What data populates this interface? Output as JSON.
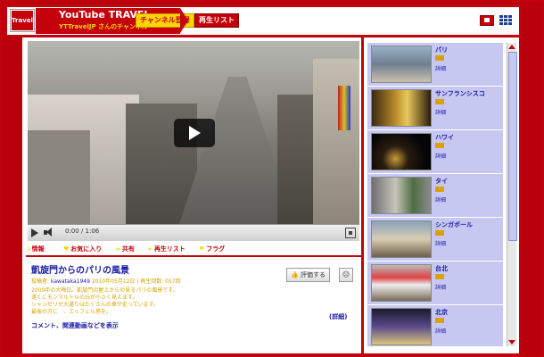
{
  "colors": {
    "brand_red": "#c4000b",
    "accent_yellow": "#ffd400",
    "link_blue": "#1a1aa6",
    "list_bg": "#c7c8f2"
  },
  "header": {
    "logo_text": "Travel",
    "title": "YouTube TRAVEL",
    "subtitle": "YTTravelJP さんのチャンネル",
    "subscribe_label": "チャンネル登録",
    "playlist_label": "再生リスト",
    "view_icons": [
      "player-view-icon",
      "grid-view-icon"
    ]
  },
  "player": {
    "time": "0:00 / 1:06",
    "icons": [
      "play-icon",
      "volume-icon",
      "fullscreen-icon"
    ]
  },
  "tabs": [
    {
      "label": "情報",
      "icon": "info-icon"
    },
    {
      "label": "お気に入り",
      "icon": "heart-icon"
    },
    {
      "label": "共有",
      "icon": "share-icon"
    },
    {
      "label": "再生リスト",
      "icon": "plus-icon"
    },
    {
      "label": "フラグ",
      "icon": "flag-icon"
    }
  ],
  "video": {
    "title": "凱旋門からのパリの風景",
    "meta_prefix": "投稿者:",
    "uploader": "kawataka1949",
    "meta_suffix": "2010年05月12日 | 再生回数: 057回",
    "description_lines": [
      "2009年の大晦日。凱旋門の屋上からの見るパリの風景です。",
      "遠くにモンマルトルの丘が小さく見えます。",
      "シャンゼリゼ大通りはたくさんの車が走っています。",
      "最後の方に　、エッフェル塔を。"
    ],
    "rate_label": "評価する",
    "dislike_symbol": "☹",
    "more_label": "(詳細)",
    "comments_label": "コメント、関連動画などを表示"
  },
  "playlist": {
    "detail_label": "詳細",
    "items": [
      {
        "title": "パリ"
      },
      {
        "title": "サンフランシスコ"
      },
      {
        "title": "ハワイ"
      },
      {
        "title": "タイ"
      },
      {
        "title": "シンガポール"
      },
      {
        "title": "台北"
      },
      {
        "title": "北京"
      }
    ]
  }
}
